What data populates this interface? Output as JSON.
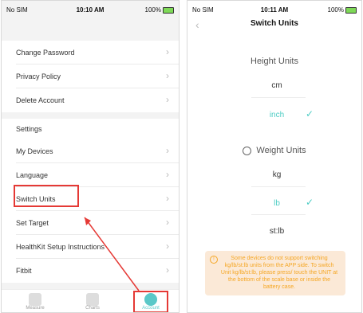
{
  "left_screen": {
    "status": {
      "carrier": "No SIM",
      "time": "10:10 AM",
      "battery": "100%"
    },
    "account_items": [
      {
        "label": "Change Password"
      },
      {
        "label": "Privacy Policy"
      },
      {
        "label": "Delete Account"
      }
    ],
    "settings_header": "Settings",
    "settings_items": [
      {
        "label": "My Devices"
      },
      {
        "label": "Language"
      },
      {
        "label": "Switch Units"
      },
      {
        "label": "Set Target"
      },
      {
        "label": "HealthKit Setup Instructions"
      },
      {
        "label": "Fitbit"
      }
    ],
    "tabs": [
      {
        "label": "Measure"
      },
      {
        "label": "Charts"
      },
      {
        "label": "Account"
      }
    ],
    "colors": {
      "accent": "#4ecdc4",
      "highlight": "#e53935"
    }
  },
  "right_screen": {
    "status": {
      "carrier": "No SIM",
      "time": "10:11 AM",
      "battery": "100%"
    },
    "title": "Switch Units",
    "height_units": {
      "title": "Height Units",
      "options": [
        {
          "label": "cm",
          "selected": false
        },
        {
          "label": "inch",
          "selected": true
        }
      ]
    },
    "weight_units": {
      "title": "Weight Units",
      "options": [
        {
          "label": "kg",
          "selected": false
        },
        {
          "label": "lb",
          "selected": true
        },
        {
          "label": "st:lb",
          "selected": false
        }
      ]
    },
    "info_text": "Some devices do not support switching kg/lb/st:lb units from the APP side. To switch Unit kg/lb/st:lb, please press/ touch the UNIT at the bottom of the scale base or inside the battery case."
  }
}
